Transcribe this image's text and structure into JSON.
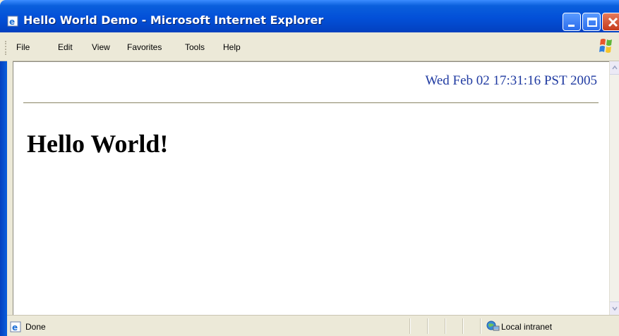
{
  "window": {
    "title": "Hello World Demo - Microsoft Internet Explorer"
  },
  "menu": {
    "items": [
      "File",
      "Edit",
      "View",
      "Favorites",
      "Tools",
      "Help"
    ]
  },
  "page": {
    "timestamp": "Wed Feb 02 17:31:16 PST 2005",
    "heading": "Hello World!"
  },
  "status": {
    "text": "Done",
    "zone": "Local intranet"
  },
  "icons": {
    "title": "ie-page-icon",
    "brand": "windows-flag-icon",
    "status": "ie-done-icon",
    "zone": "local-intranet-icon"
  },
  "colors": {
    "titlebar": "#0350d8",
    "timestamp_text": "#1f3aa1",
    "chrome": "#ece9d8"
  }
}
